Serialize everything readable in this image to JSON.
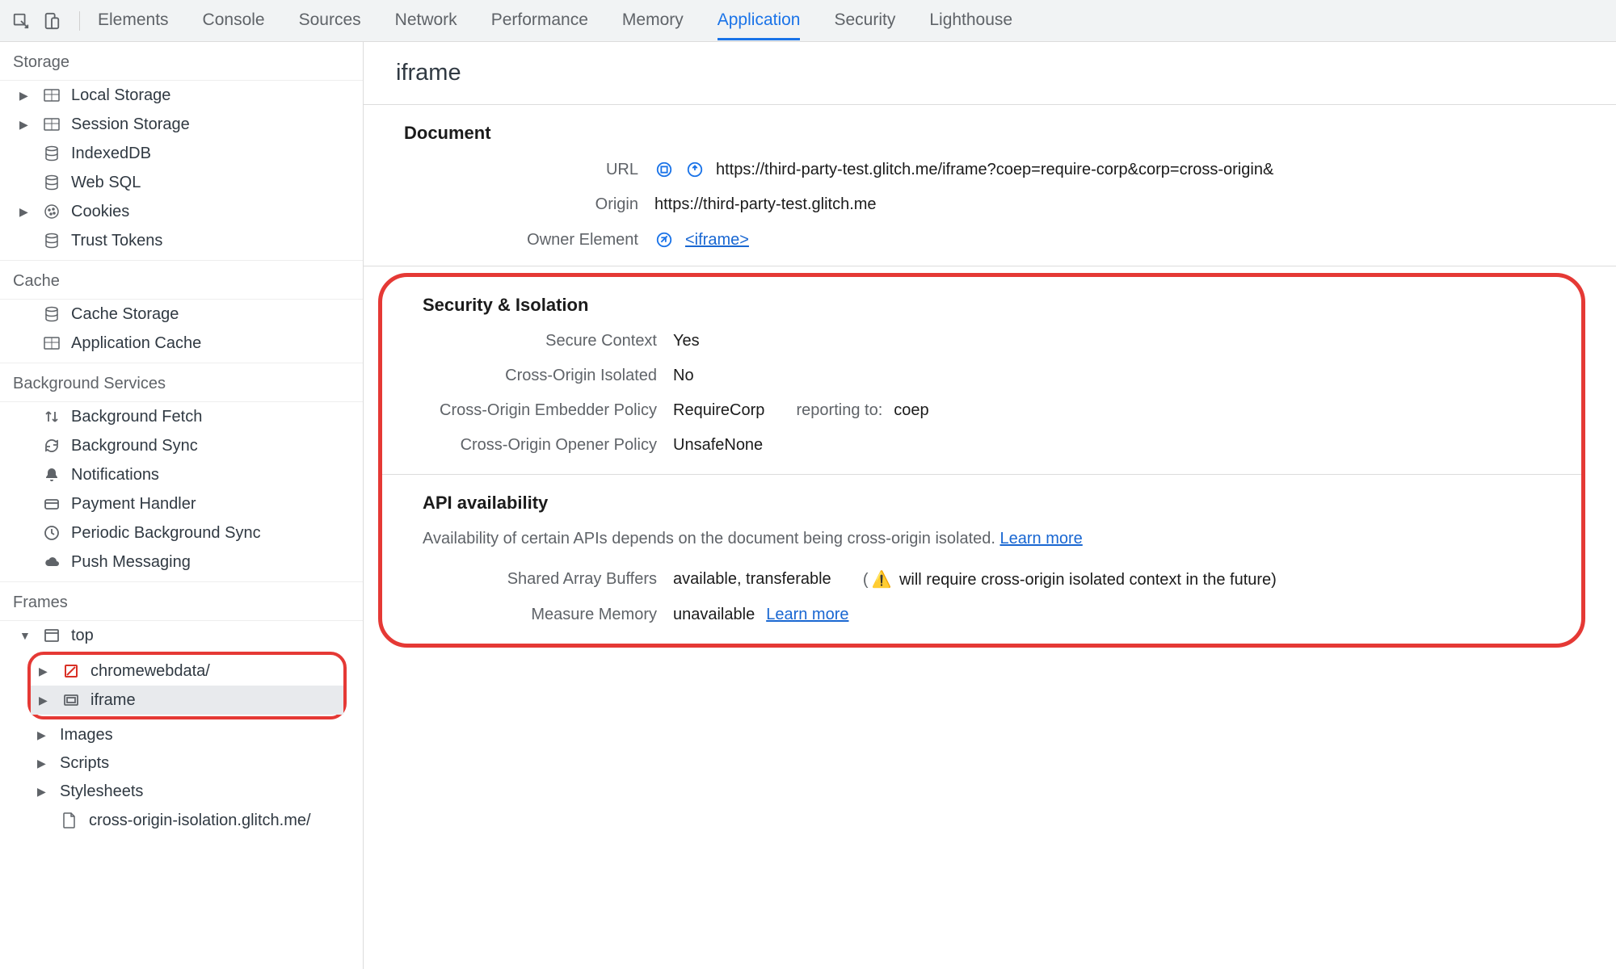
{
  "toolbar": {
    "tabs": [
      "Elements",
      "Console",
      "Sources",
      "Network",
      "Performance",
      "Memory",
      "Application",
      "Security",
      "Lighthouse"
    ],
    "active_tab": "Application"
  },
  "sidebar": {
    "storage": {
      "title": "Storage",
      "items": [
        {
          "label": "Local Storage",
          "icon": "table-icon",
          "expandable": true
        },
        {
          "label": "Session Storage",
          "icon": "table-icon",
          "expandable": true
        },
        {
          "label": "IndexedDB",
          "icon": "db-icon",
          "expandable": false
        },
        {
          "label": "Web SQL",
          "icon": "db-icon",
          "expandable": false
        },
        {
          "label": "Cookies",
          "icon": "cookie-icon",
          "expandable": true
        },
        {
          "label": "Trust Tokens",
          "icon": "db-icon",
          "expandable": false
        }
      ]
    },
    "cache": {
      "title": "Cache",
      "items": [
        {
          "label": "Cache Storage",
          "icon": "db-icon"
        },
        {
          "label": "Application Cache",
          "icon": "table-icon"
        }
      ]
    },
    "bg": {
      "title": "Background Services",
      "items": [
        {
          "label": "Background Fetch",
          "icon": "updown-icon"
        },
        {
          "label": "Background Sync",
          "icon": "sync-icon"
        },
        {
          "label": "Notifications",
          "icon": "bell-icon"
        },
        {
          "label": "Payment Handler",
          "icon": "card-icon"
        },
        {
          "label": "Periodic Background Sync",
          "icon": "clock-icon"
        },
        {
          "label": "Push Messaging",
          "icon": "cloud-icon"
        }
      ]
    },
    "frames": {
      "title": "Frames",
      "top": "top",
      "children": [
        {
          "label": "chromewebdata/",
          "icon": "blocked-icon",
          "color": "#d93025"
        },
        {
          "label": "iframe",
          "icon": "frame-icon",
          "selected": true
        }
      ],
      "more": [
        {
          "label": "Images"
        },
        {
          "label": "Scripts"
        },
        {
          "label": "Stylesheets"
        },
        {
          "label": "cross-origin-isolation.glitch.me/",
          "icon": "file-icon",
          "expandable": false
        }
      ]
    }
  },
  "panel": {
    "title": "iframe",
    "document": {
      "heading": "Document",
      "url_label": "URL",
      "url_value": "https://third-party-test.glitch.me/iframe?coep=require-corp&corp=cross-origin&",
      "origin_label": "Origin",
      "origin_value": "https://third-party-test.glitch.me",
      "owner_label": "Owner Element",
      "owner_value": "<iframe>"
    },
    "security": {
      "heading": "Security & Isolation",
      "rows": [
        {
          "label": "Secure Context",
          "value": "Yes"
        },
        {
          "label": "Cross-Origin Isolated",
          "value": "No"
        },
        {
          "label": "Cross-Origin Embedder Policy",
          "value": "RequireCorp",
          "report_label": "reporting to:",
          "report_value": "coep"
        },
        {
          "label": "Cross-Origin Opener Policy",
          "value": "UnsafeNone"
        }
      ]
    },
    "api": {
      "heading": "API availability",
      "note": "Availability of certain APIs depends on the document being cross-origin isolated.",
      "learn_more": "Learn more",
      "rows": [
        {
          "label": "Shared Array Buffers",
          "value": "available, transferable",
          "warn_note": "will require cross-origin isolated context in the future)"
        },
        {
          "label": "Measure Memory",
          "value": "unavailable",
          "link": "Learn more"
        }
      ]
    }
  }
}
